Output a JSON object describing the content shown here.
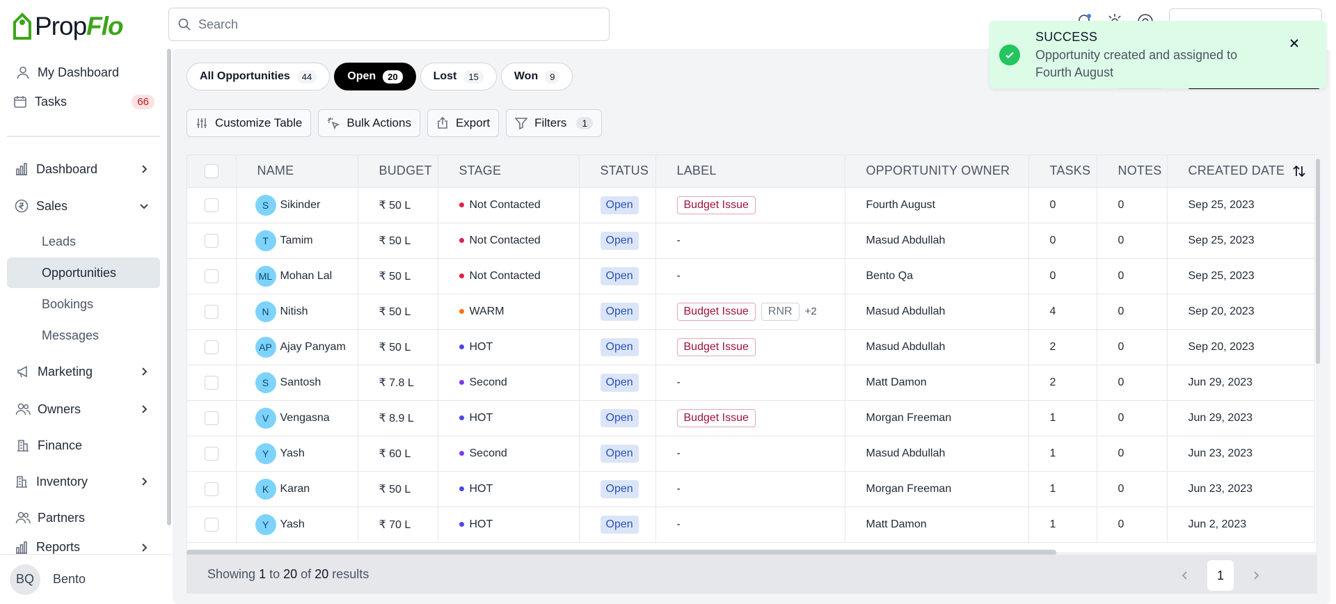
{
  "app": {
    "logo_prefix": "Prop",
    "logo_suffix": "Flo"
  },
  "search": {
    "placeholder": "Search"
  },
  "sidebar": {
    "my_dashboard": "My Dashboard",
    "tasks": "Tasks",
    "tasks_count": "66",
    "dashboard": "Dashboard",
    "sales": "Sales",
    "sales_sub": [
      "Leads",
      "Opportunities",
      "Bookings",
      "Messages"
    ],
    "marketing": "Marketing",
    "owners": "Owners",
    "finance": "Finance",
    "inventory": "Inventory",
    "partners": "Partners",
    "reports": "Reports",
    "user_initials": "BQ",
    "user_name": "Bento"
  },
  "tabs": [
    {
      "label": "All Opportunities",
      "count": "44"
    },
    {
      "label": "Open",
      "count": "20"
    },
    {
      "label": "Lost",
      "count": "15"
    },
    {
      "label": "Won",
      "count": "9"
    }
  ],
  "actions": {
    "customize": "Customize Table",
    "bulk": "Bulk Actions",
    "export": "Export",
    "filters": "Filters",
    "filters_count": "1"
  },
  "table": {
    "headers": [
      "NAME",
      "BUDGET",
      "STAGE",
      "STATUS",
      "LABEL",
      "OPPORTUNITY OWNER",
      "TASKS",
      "NOTES",
      "CREATED DATE"
    ],
    "rows": [
      {
        "initials": "S",
        "name": "Sikinder",
        "budget": "₹ 50 L",
        "stage": "Not Contacted",
        "stage_color": "#e11d48",
        "status": "Open",
        "labels": [
          "Budget Issue"
        ],
        "owner": "Fourth August",
        "tasks": "0",
        "notes": "0",
        "date": "Sep 25, 2023"
      },
      {
        "initials": "T",
        "name": "Tamim",
        "budget": "₹ 50 L",
        "stage": "Not Contacted",
        "stage_color": "#e11d48",
        "status": "Open",
        "labels": [],
        "owner": "Masud Abdullah",
        "tasks": "0",
        "notes": "0",
        "date": "Sep 25, 2023"
      },
      {
        "initials": "ML",
        "name": "Mohan Lal",
        "budget": "₹ 50 L",
        "stage": "Not Contacted",
        "stage_color": "#e11d48",
        "status": "Open",
        "labels": [],
        "owner": "Bento Qa",
        "tasks": "0",
        "notes": "0",
        "date": "Sep 25, 2023"
      },
      {
        "initials": "N",
        "name": "Nitish",
        "budget": "₹ 50 L",
        "stage": "WARM",
        "stage_color": "#f97316",
        "status": "Open",
        "labels": [
          "Budget Issue",
          "RNR"
        ],
        "more": "+2",
        "owner": "Masud Abdullah",
        "tasks": "4",
        "notes": "0",
        "date": "Sep 20, 2023"
      },
      {
        "initials": "AP",
        "name": "Ajay Panyam",
        "budget": "₹ 50 L",
        "stage": "HOT",
        "stage_color": "#4f46e5",
        "status": "Open",
        "labels": [
          "Budget Issue"
        ],
        "owner": "Masud Abdullah",
        "tasks": "2",
        "notes": "0",
        "date": "Sep 20, 2023"
      },
      {
        "initials": "S",
        "name": "Santosh",
        "budget": "₹ 7.8 L",
        "stage": "Second",
        "stage_color": "#7c3aed",
        "status": "Open",
        "labels": [],
        "owner": "Matt Damon",
        "tasks": "2",
        "notes": "0",
        "date": "Jun 29, 2023"
      },
      {
        "initials": "V",
        "name": "Vengasna",
        "budget": "₹ 8.9 L",
        "stage": "HOT",
        "stage_color": "#4f46e5",
        "status": "Open",
        "labels": [
          "Budget Issue"
        ],
        "owner": "Morgan Freeman",
        "tasks": "1",
        "notes": "0",
        "date": "Jun 29, 2023"
      },
      {
        "initials": "Y",
        "name": "Yash",
        "budget": "₹ 60 L",
        "stage": "Second",
        "stage_color": "#7c3aed",
        "status": "Open",
        "labels": [],
        "owner": "Masud Abdullah",
        "tasks": "1",
        "notes": "0",
        "date": "Jun 23, 2023"
      },
      {
        "initials": "K",
        "name": "Karan",
        "budget": "₹ 50 L",
        "stage": "HOT",
        "stage_color": "#4f46e5",
        "status": "Open",
        "labels": [],
        "owner": "Morgan Freeman",
        "tasks": "1",
        "notes": "0",
        "date": "Jun 23, 2023"
      },
      {
        "initials": "Y",
        "name": "Yash",
        "budget": "₹ 70 L",
        "stage": "HOT",
        "stage_color": "#4f46e5",
        "status": "Open",
        "labels": [],
        "owner": "Matt Damon",
        "tasks": "1",
        "notes": "0",
        "date": "Jun 2, 2023"
      }
    ],
    "empty_label": "-"
  },
  "footer": {
    "prefix": "Showing",
    "from": "1",
    "to_word": "to",
    "to": "20",
    "of_word": "of",
    "total": "20",
    "suffix": "results",
    "page": "1"
  },
  "toast": {
    "title": "SUCCESS",
    "message": "Opportunity created and assigned to Fourth August"
  }
}
